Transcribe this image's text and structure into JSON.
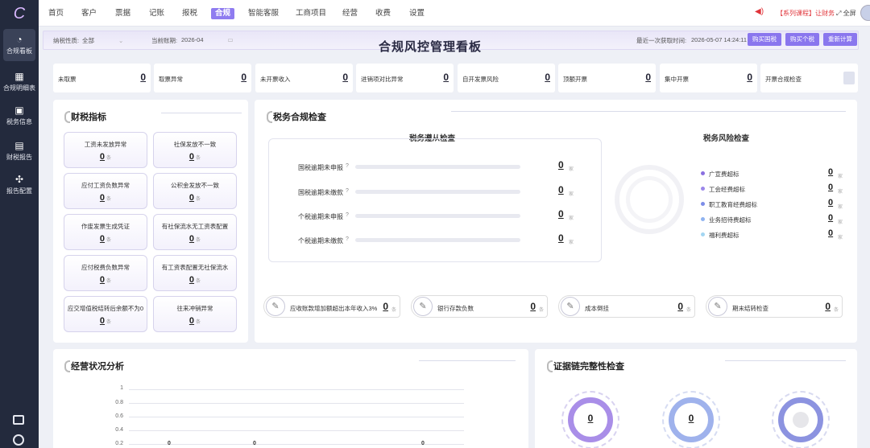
{
  "sidebar": {
    "logo": "C",
    "items": [
      {
        "label": "合规看板",
        "icon": "dashboard-icon",
        "glyph": "◔"
      },
      {
        "label": "合规明细表",
        "icon": "calendar-icon",
        "glyph": "▦"
      },
      {
        "label": "税务信息",
        "icon": "monitor-icon",
        "glyph": "▣"
      },
      {
        "label": "财税报告",
        "icon": "report-icon",
        "glyph": "▤"
      },
      {
        "label": "报告配置",
        "icon": "config-icon",
        "glyph": "✣"
      }
    ],
    "bottom_icons": [
      "download-monitor-icon",
      "settings-round-icon"
    ]
  },
  "topnav": {
    "items": [
      "首页",
      "客户",
      "票据",
      "记账",
      "报税",
      "合规",
      "智能客服",
      "工商项目",
      "经营",
      "收费",
      "设置"
    ],
    "active": "合规",
    "course_text": "【系列课程】让财务",
    "fullscreen": "全屏"
  },
  "header": {
    "taxpayer_label": "纳税性质:",
    "taxpayer_value": "全部",
    "period_label": "当前账期:",
    "period_value": "2026-04",
    "title": "合规风控管理看板",
    "last_fetch_label": "最近一次获取时间:",
    "last_fetch_value": "2026-05-07 14:24:11",
    "buttons": [
      "购买国税",
      "购买个税",
      "重新计算"
    ]
  },
  "alerts": [
    {
      "label": "未取票",
      "value": "0"
    },
    {
      "label": "取票异常",
      "value": "0"
    },
    {
      "label": "未开票收入",
      "value": "0"
    },
    {
      "label": "进销项对比异常",
      "value": "0"
    },
    {
      "label": "自开发票风险",
      "value": "0"
    },
    {
      "label": "顶额开票",
      "value": "0"
    },
    {
      "label": "集中开票",
      "value": "0"
    },
    {
      "label": "开票合规检查",
      "value": ""
    }
  ],
  "finance": {
    "title": "财税指标",
    "unit": "条",
    "cards": [
      {
        "label": "工资未发放异常",
        "value": "0"
      },
      {
        "label": "社保发放不一致",
        "value": "0"
      },
      {
        "label": "应付工资负数异常",
        "value": "0"
      },
      {
        "label": "公积金发放不一致",
        "value": "0"
      },
      {
        "label": "作废发票生成凭证",
        "value": "0"
      },
      {
        "label": "有社保流水无工资表配置",
        "value": "0"
      },
      {
        "label": "应付税费负数异常",
        "value": "0"
      },
      {
        "label": "有工资表配置无社保流水",
        "value": "0"
      },
      {
        "label": "应交增值税结转后余额不为0",
        "value": "0"
      },
      {
        "label": "往来冲销异常",
        "value": "0"
      }
    ]
  },
  "compliance": {
    "title": "税务合规检查",
    "subtitle_left": "税务遵从检查",
    "subtitle_right": "税务风险检查",
    "unit": "家",
    "rows": [
      {
        "label": "国税逾期未申报",
        "value": "0"
      },
      {
        "label": "国税逾期未缴款",
        "value": "0"
      },
      {
        "label": "个税逾期未申报",
        "value": "0"
      },
      {
        "label": "个税逾期未缴款",
        "value": "0"
      }
    ],
    "risks": [
      {
        "label": "广宣费超标",
        "value": "0",
        "color": "#8a6fe0"
      },
      {
        "label": "工会经费超标",
        "value": "0",
        "color": "#9b87ea"
      },
      {
        "label": "职工教育经费超标",
        "value": "0",
        "color": "#7d8de8"
      },
      {
        "label": "业务招待费超标",
        "value": "0",
        "color": "#8fb3f0"
      },
      {
        "label": "福利费超标",
        "value": "0",
        "color": "#a3d6f2"
      }
    ],
    "bottom": [
      {
        "label": "应收账款增加额超出本年收入3%",
        "value": "0"
      },
      {
        "label": "银行存款负数",
        "value": "0"
      },
      {
        "label": "成本倒挂",
        "value": "0"
      },
      {
        "label": "期末结转检查",
        "value": "0"
      }
    ],
    "bottom_unit": "条"
  },
  "operations": {
    "title": "经营状况分析"
  },
  "chart_data": {
    "type": "line",
    "y_ticks": [
      "1",
      "0.8",
      "0.6",
      "0.4",
      "0.2"
    ],
    "ylim": [
      0,
      1
    ],
    "data_labels": [
      "0",
      "0",
      "0"
    ]
  },
  "evidence": {
    "title": "证据链完整性检查",
    "rings": [
      {
        "value": "0",
        "color": "#a98ee8"
      },
      {
        "value": "0",
        "color": "#9fb2ec"
      },
      {
        "value": "",
        "color": "#8c93e0"
      }
    ]
  }
}
